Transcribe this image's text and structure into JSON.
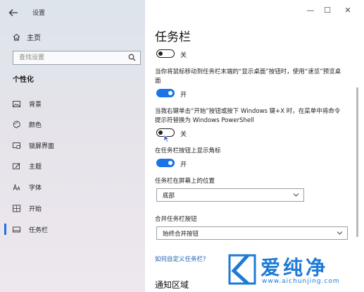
{
  "sidebar": {
    "title": "设置",
    "home_label": "主页",
    "search_placeholder": "查找设置",
    "section_label": "个性化",
    "items": [
      {
        "label": "背景",
        "icon": "picture-icon"
      },
      {
        "label": "颜色",
        "icon": "palette-icon"
      },
      {
        "label": "锁屏界面",
        "icon": "lock-screen-icon"
      },
      {
        "label": "主题",
        "icon": "theme-icon"
      },
      {
        "label": "字体",
        "icon": "font-icon"
      },
      {
        "label": "开始",
        "icon": "start-icon"
      },
      {
        "label": "任务栏",
        "icon": "taskbar-icon",
        "active": true
      }
    ]
  },
  "window": {
    "minimize": "—",
    "maximize": "☐",
    "close": "✕"
  },
  "main": {
    "title": "任务栏",
    "toggles": [
      {
        "state": "off",
        "label": "关"
      },
      {
        "description": "当你将鼠标移动到任务栏末端的“显示桌面”按钮时，使用“速览”预览桌面",
        "state": "on",
        "label": "开"
      },
      {
        "description": "当我右键单击“开始”按钮或按下 Windows 键+X 时，在菜单中将命令提示符替换为 Windows PowerShell",
        "state": "off",
        "label": "关"
      },
      {
        "description": "在任务栏按钮上显示角标",
        "state": "on",
        "label": "开"
      }
    ],
    "position": {
      "label": "任务栏在屏幕上的位置",
      "value": "底部"
    },
    "combine": {
      "label": "合并任务栏按钮",
      "value": "始终合并按钮"
    },
    "link": "如何自定义任务栏?",
    "subheading": "通知区域"
  },
  "watermark": {
    "text": "爱纯净",
    "url": "www.aichunjing.com"
  },
  "colors": {
    "accent": "#1a73e8",
    "watermark": "#1d7bd6"
  }
}
